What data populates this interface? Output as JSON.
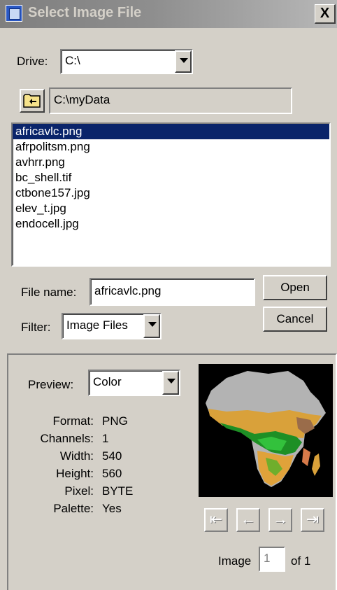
{
  "window": {
    "title": "Select Image File",
    "close_glyph": "X"
  },
  "drive": {
    "label": "Drive:",
    "value": "C:\\"
  },
  "path": {
    "value": "C:\\myData"
  },
  "files": [
    "africavlc.png",
    "afrpolitsm.png",
    "avhrr.png",
    "bc_shell.tif",
    "ctbone157.jpg",
    "elev_t.jpg",
    "endocell.jpg"
  ],
  "selected_index": 0,
  "filename": {
    "label": "File name:",
    "value": "africavlc.png"
  },
  "filter": {
    "label": "Filter:",
    "value": "Image Files"
  },
  "buttons": {
    "open": "Open",
    "cancel": "Cancel"
  },
  "preview": {
    "label": "Preview:",
    "mode": "Color",
    "info": [
      {
        "label": "Format:",
        "value": "PNG"
      },
      {
        "label": "Channels:",
        "value": "1"
      },
      {
        "label": "Width:",
        "value": "540"
      },
      {
        "label": "Height:",
        "value": "560"
      },
      {
        "label": "Pixel:",
        "value": "BYTE"
      },
      {
        "label": "Palette:",
        "value": "Yes"
      }
    ],
    "image_label": "Image",
    "image_index": "1",
    "image_of": "of 1"
  },
  "nav_icons": [
    "first-icon",
    "prev-icon",
    "next-icon",
    "last-icon"
  ],
  "colors": {
    "selection": "#0a246a",
    "dialog_bg": "#d4d0c8"
  }
}
